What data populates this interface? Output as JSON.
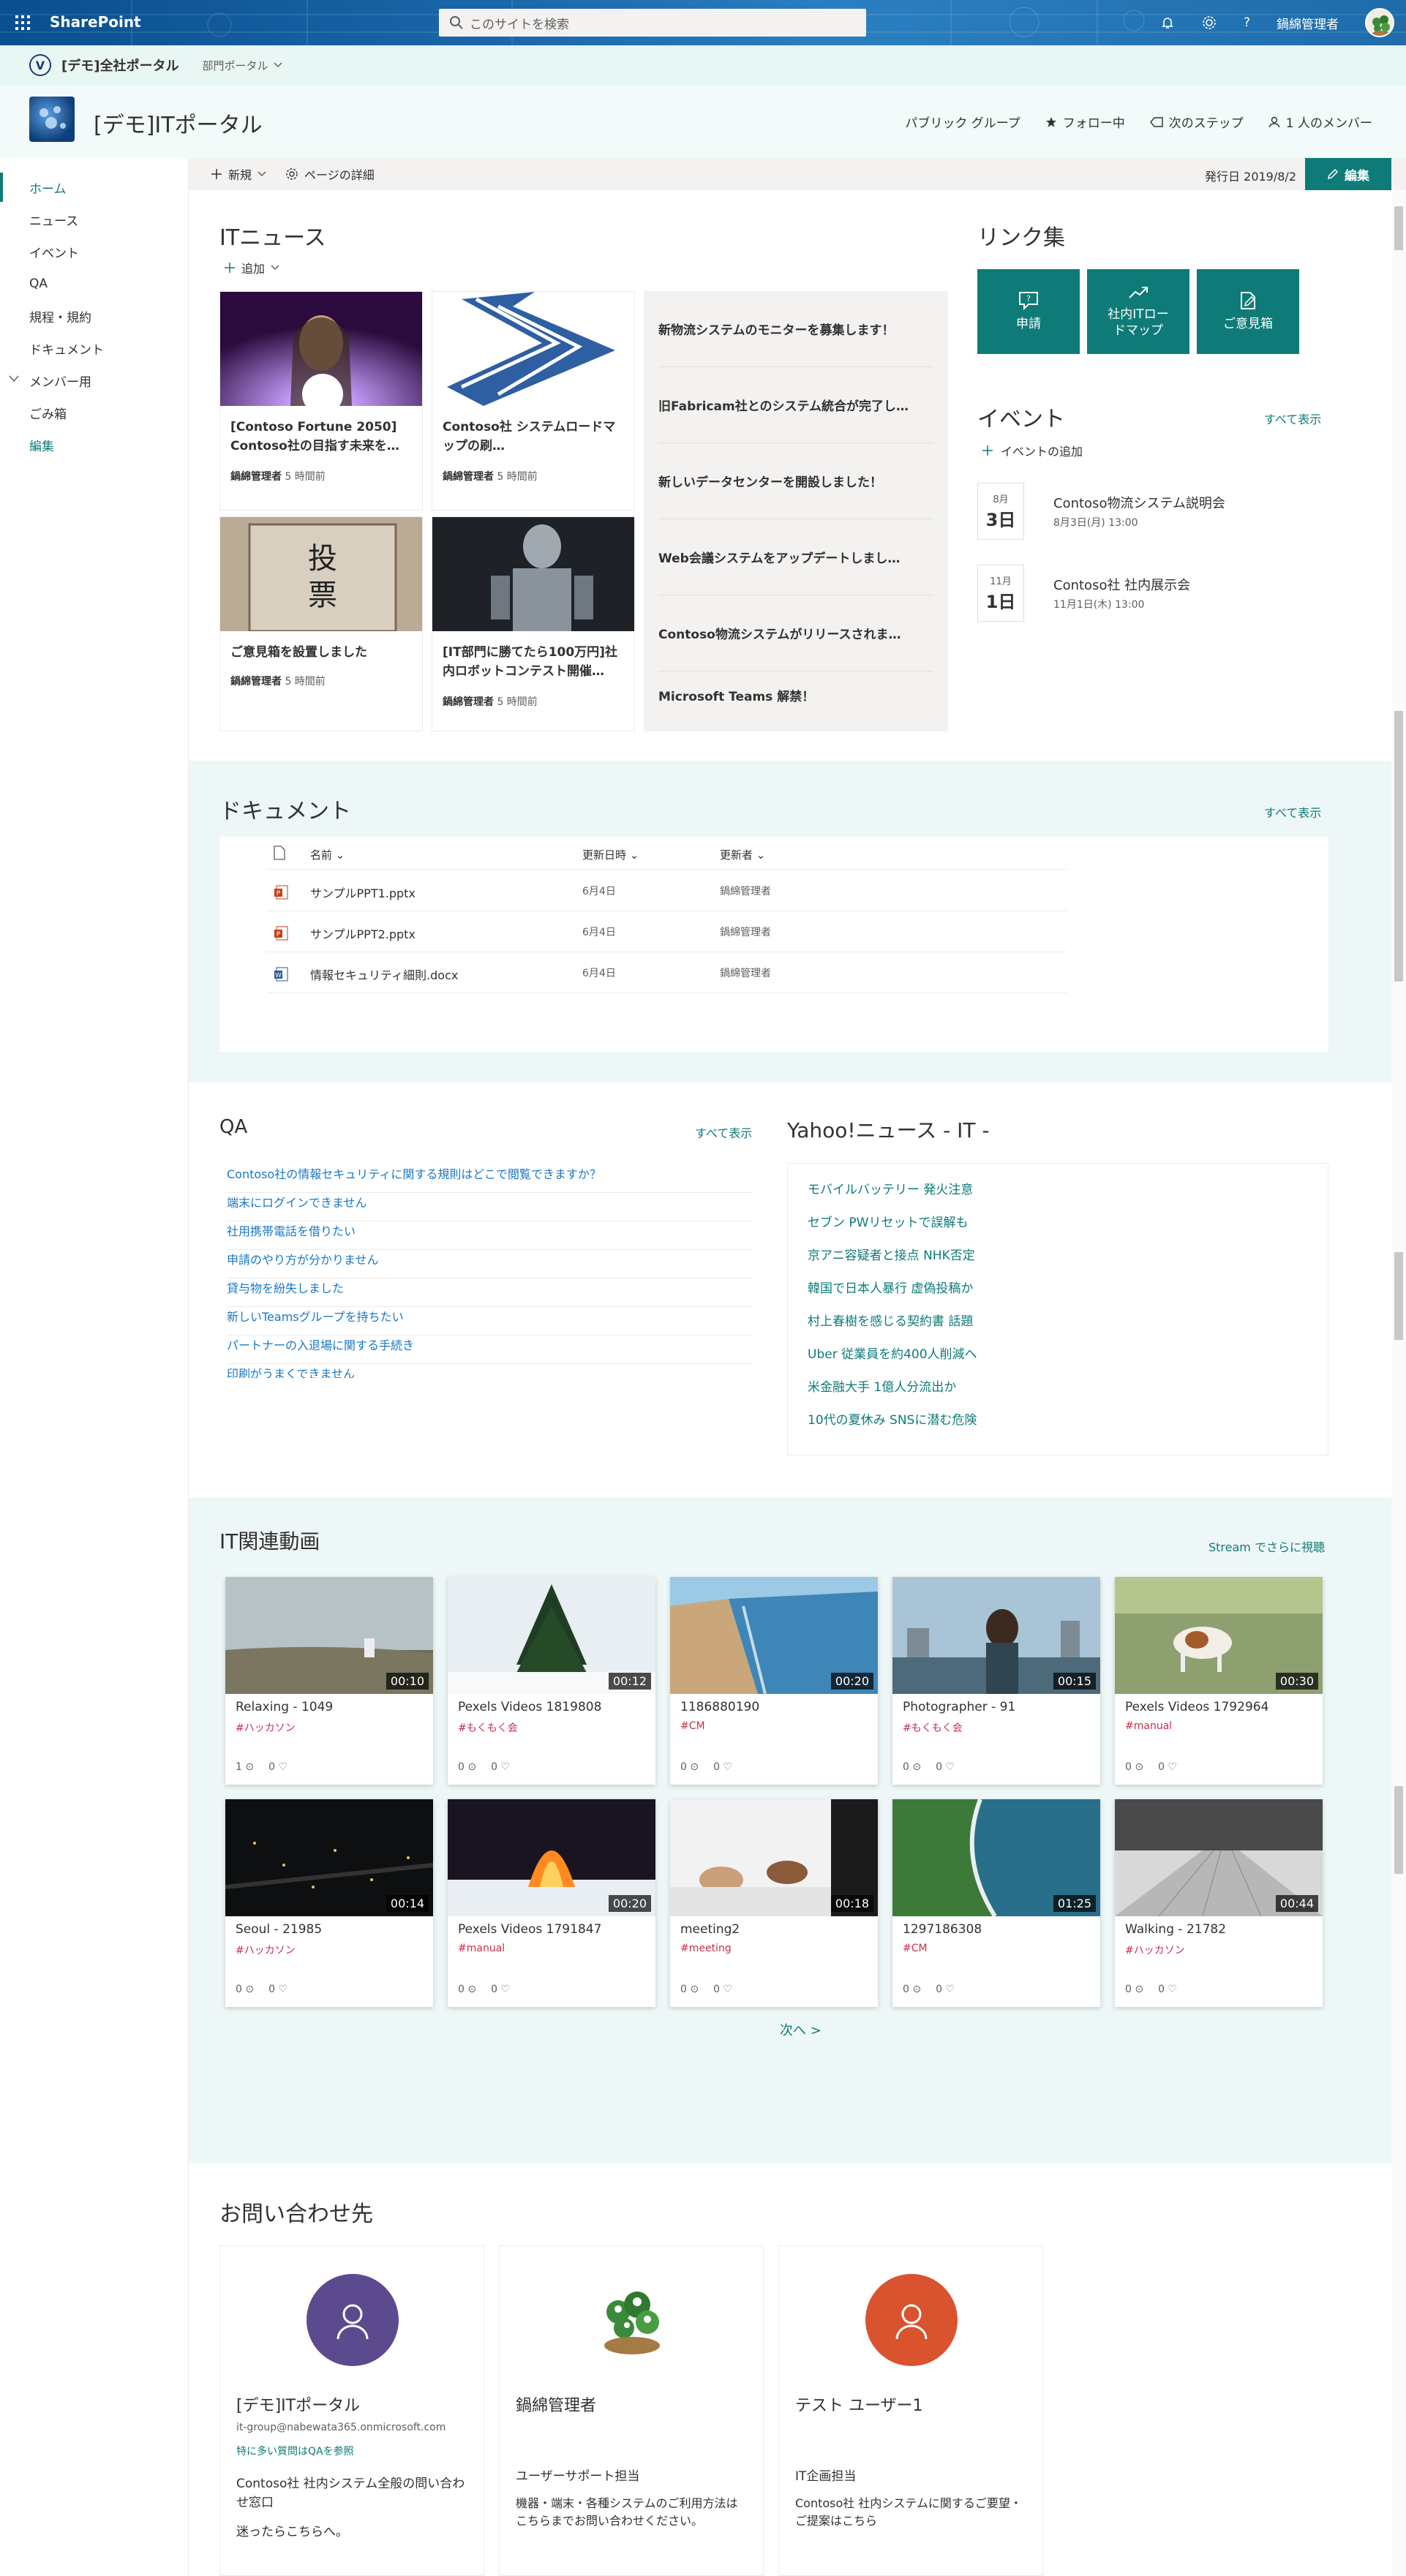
{
  "suitebar": {
    "brand": "SharePoint",
    "search_placeholder": "このサイトを検索",
    "user_name": "鍋綿管理者",
    "help": "?"
  },
  "hub": {
    "title": "[デモ]全社ポータル",
    "sub": "部門ポータル"
  },
  "site": {
    "title": "[デモ]ITポータル",
    "group_type": "パブリック グループ",
    "follow": "フォロー中",
    "next_steps": "次のステップ",
    "members": "1 人のメンバー"
  },
  "command": {
    "new": "新規",
    "page_details": "ページの詳細",
    "published": "発行日 2019/8/2",
    "edit": "編集"
  },
  "nav": [
    {
      "label": "ホーム"
    },
    {
      "label": "ニュース"
    },
    {
      "label": "イベント"
    },
    {
      "label": "QA"
    },
    {
      "label": "規程・規約"
    },
    {
      "label": "ドキュメント"
    },
    {
      "label": "メンバー用"
    },
    {
      "label": "ごみ箱"
    },
    {
      "label": "編集"
    }
  ],
  "news": {
    "title": "ITニュース",
    "add": "追加",
    "cards": [
      {
        "title": "[Contoso Fortune 2050] Contoso社の目指す未来を…",
        "author": "鍋綿管理者",
        "time": "5 時間前"
      },
      {
        "title": "Contoso社 システムロードマップの刷…",
        "author": "鍋綿管理者",
        "time": "5 時間前"
      },
      {
        "title": "ご意見箱を設置しました",
        "author": "鍋綿管理者",
        "time": "5 時間前"
      },
      {
        "title": "[IT部門に勝てたら100万円]社内ロボットコンテスト開催…",
        "author": "鍋綿管理者",
        "time": "5 時間前"
      }
    ],
    "headlines": [
      "新物流システムのモニターを募集します！",
      "旧Fabricam社とのシステム統合が完了し…",
      "新しいデータセンターを開設しました！",
      "Web会議システムをアップデートしまし…",
      "Contoso物流システムがリリースされま…",
      "Microsoft Teams 解禁！"
    ]
  },
  "links": {
    "title": "リンク集",
    "items": [
      {
        "label": "申請"
      },
      {
        "label": "社内ITロードマップ"
      },
      {
        "label": "ご意見箱"
      }
    ]
  },
  "events": {
    "title": "イベント",
    "see_all": "すべて表示",
    "add": "イベントの追加",
    "items": [
      {
        "month": "8月",
        "day": "3日",
        "title": "Contoso物流システム説明会",
        "sub": "8月3日(月) 13:00"
      },
      {
        "month": "11月",
        "day": "1日",
        "title": "Contoso社 社内展示会",
        "sub": "11月1日(木) 13:00"
      }
    ]
  },
  "documents": {
    "title": "ドキュメント",
    "see_all": "すべて表示",
    "columns": {
      "name": "名前",
      "modified": "更新日時",
      "modified_by": "更新者"
    },
    "rows": [
      {
        "name": "サンプルPPT1.pptx",
        "modified": "6月4日",
        "by": "鍋綿管理者",
        "type": "pptx"
      },
      {
        "name": "サンプルPPT2.pptx",
        "modified": "6月4日",
        "by": "鍋綿管理者",
        "type": "pptx"
      },
      {
        "name": "情報セキュリティ細則.docx",
        "modified": "6月4日",
        "by": "鍋綿管理者",
        "type": "docx"
      }
    ]
  },
  "qa": {
    "title": "QA",
    "see_all": "すべて表示",
    "items": [
      "Contoso社の情報セキュリティに関する規則はどこで閲覧できますか？",
      "端末にログインできません",
      "社用携帯電話を借りたい",
      "申請のやり方が分かりません",
      "貸与物を紛失しました",
      "新しいTeamsグループを持ちたい",
      "パートナーの入退場に関する手続き"
    ],
    "partial_item": "印刷がうまくできません"
  },
  "yahoo": {
    "title": "Yahoo!ニュース - IT -",
    "items": [
      "モバイルバッテリー 発火注意",
      "セブン PWリセットで誤解も",
      "京アニ容疑者と接点 NHK否定",
      "韓国で日本人暴行 虚偽投稿か",
      "村上春樹を感じる契約書 話題",
      "Uber 従業員を約400人削減へ",
      "米金融大手 1億人分流出か",
      "10代の夏休み SNSに潜む危険"
    ]
  },
  "videos": {
    "title": "IT関連動画",
    "see_more": "Stream でさらに視聴",
    "next": "次へ >",
    "items": [
      {
        "title": "Relaxing - 1049",
        "tag": "#ハッカソン",
        "dur": "00:10",
        "views": "1",
        "likes": "0",
        "scene": "beach"
      },
      {
        "title": "Pexels Videos 1819808",
        "tag": "#もくもく会",
        "dur": "00:12",
        "views": "0",
        "likes": "0",
        "scene": "snow"
      },
      {
        "title": "1186880190",
        "tag": "#CM",
        "dur": "00:20",
        "views": "0",
        "likes": "0",
        "scene": "coast"
      },
      {
        "title": "Photographer - 91",
        "tag": "#もくもく会",
        "dur": "00:15",
        "views": "0",
        "likes": "0",
        "scene": "city"
      },
      {
        "title": "Pexels Videos 1792964",
        "tag": "#manual",
        "dur": "00:30",
        "views": "0",
        "likes": "0",
        "scene": "field"
      },
      {
        "title": "Seoul - 21985",
        "tag": "#ハッカソン",
        "dur": "00:14",
        "views": "0",
        "likes": "0",
        "scene": "night"
      },
      {
        "title": "Pexels Videos 1791847",
        "tag": "#manual",
        "dur": "00:20",
        "views": "0",
        "likes": "0",
        "scene": "fire"
      },
      {
        "title": "meeting2",
        "tag": "#meeting",
        "dur": "00:18",
        "views": "0",
        "likes": "0",
        "scene": "meeting"
      },
      {
        "title": "1297186308",
        "tag": "#CM",
        "dur": "01:25",
        "views": "0",
        "likes": "0",
        "scene": "sea"
      },
      {
        "title": "Walking - 21782",
        "tag": "#ハッカソン",
        "dur": "00:44",
        "views": "0",
        "likes": "0",
        "scene": "street"
      }
    ]
  },
  "contacts": {
    "title": "お問い合わせ先",
    "items": [
      {
        "name": "[デモ]ITポータル",
        "email": "it-group@nabewata365.onmicrosoft.com",
        "qa": "特に多い質問はQAを参照",
        "role": "",
        "desc": "Contoso社 社内システム全般の問い合わせ窓口",
        "desc2": "迷ったらこちらへ。",
        "color": "#5c4a8e"
      },
      {
        "name": "鍋綿管理者",
        "email": "",
        "qa": "",
        "role": "ユーザーサポート担当",
        "desc": "機器・端末・各種システムのご利用方法はこちらまでお問い合わせください。",
        "desc2": "",
        "color": "#e8f3e4"
      },
      {
        "name": "テスト ユーザー1",
        "email": "",
        "qa": "",
        "role": "IT企画担当",
        "desc": "Contoso社 社内システムに関するご要望・ご提案はこちら",
        "desc2": "",
        "color": "#d9532e"
      }
    ]
  },
  "colors": {
    "accent": "#0f7b78",
    "suitebar": "#1a66a8",
    "hub": "#e8f6f4",
    "band": "#eef7f7",
    "tag": "#c4314b",
    "link": "#1778c8"
  }
}
